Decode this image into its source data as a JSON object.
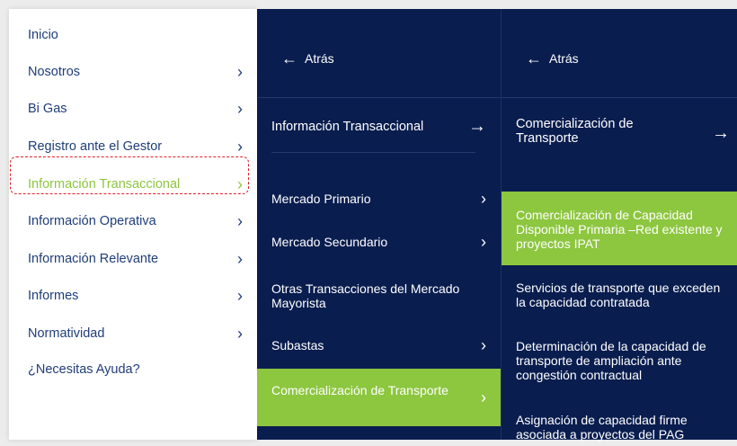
{
  "col1": {
    "items": [
      {
        "label": "Inicio",
        "chevron": false
      },
      {
        "label": "Nosotros",
        "chevron": true
      },
      {
        "label": "Bi Gas",
        "chevron": true
      },
      {
        "label": "Registro ante el Gestor",
        "chevron": true
      },
      {
        "label": "Información Transaccional",
        "chevron": true,
        "active": true
      },
      {
        "label": "Información Operativa",
        "chevron": true
      },
      {
        "label": "Información Relevante",
        "chevron": true
      },
      {
        "label": "Informes",
        "chevron": true
      },
      {
        "label": "Normatividad",
        "chevron": true
      },
      {
        "label": "¿Necesitas Ayuda?",
        "chevron": false
      }
    ]
  },
  "col2": {
    "back_label": "Atrás",
    "heading": "Información Transaccional",
    "items": [
      {
        "label": "Mercado Primario"
      },
      {
        "label": "Mercado Secundario"
      },
      {
        "label": "Otras Transacciones del Mercado Mayorista"
      },
      {
        "label": "Subastas"
      },
      {
        "label": "Comercialización de Transporte",
        "active": true
      }
    ]
  },
  "col3": {
    "back_label": "Atrás",
    "heading": "Comercialización de Transporte",
    "items": [
      {
        "label": "Comercialización de Capacidad Disponible Primaria –Red existente y proyectos IPAT",
        "active": true
      },
      {
        "label": "Servicios de transporte que exceden la capacidad contratada"
      },
      {
        "label": "Determinación de la capacidad de transporte de ampliación ante congestión contractual"
      },
      {
        "label": "Asignación de capacidad firme asociada a proyectos del PAG"
      }
    ]
  },
  "colors": {
    "navy": "#0a1d4f",
    "green": "#8dc63f",
    "text_blue": "#1f3d7a",
    "highlight_red": "#e0202a"
  },
  "icons": {
    "chevron": "chevron-right-icon",
    "back": "arrow-left-icon",
    "forward": "arrow-right-icon"
  }
}
